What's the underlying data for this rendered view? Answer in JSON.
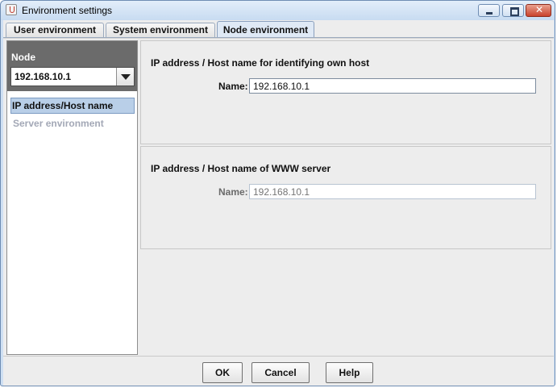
{
  "window": {
    "title": "Environment settings"
  },
  "tabs": [
    {
      "label": "User environment"
    },
    {
      "label": "System environment"
    },
    {
      "label": "Node environment",
      "active": true
    }
  ],
  "node": {
    "label": "Node",
    "selected_value": "192.168.10.1"
  },
  "nav": {
    "items": [
      {
        "label": "IP address/Host name",
        "selected": true
      },
      {
        "label": "Server environment",
        "enabled": false
      }
    ]
  },
  "own_host": {
    "title": "IP address / Host name for identifying own host",
    "name_label": "Name:",
    "name_value": "192.168.10.1"
  },
  "www_server": {
    "title": "IP address / Host name of WWW server",
    "name_label": "Name:",
    "name_placeholder": "192.168.10.1"
  },
  "buttons": {
    "ok": "OK",
    "cancel": "Cancel",
    "help": "Help"
  },
  "colors": {
    "accent_selected": "#b9cfe8",
    "node_header": "#6b6b6b",
    "close_button": "#c9422c"
  }
}
